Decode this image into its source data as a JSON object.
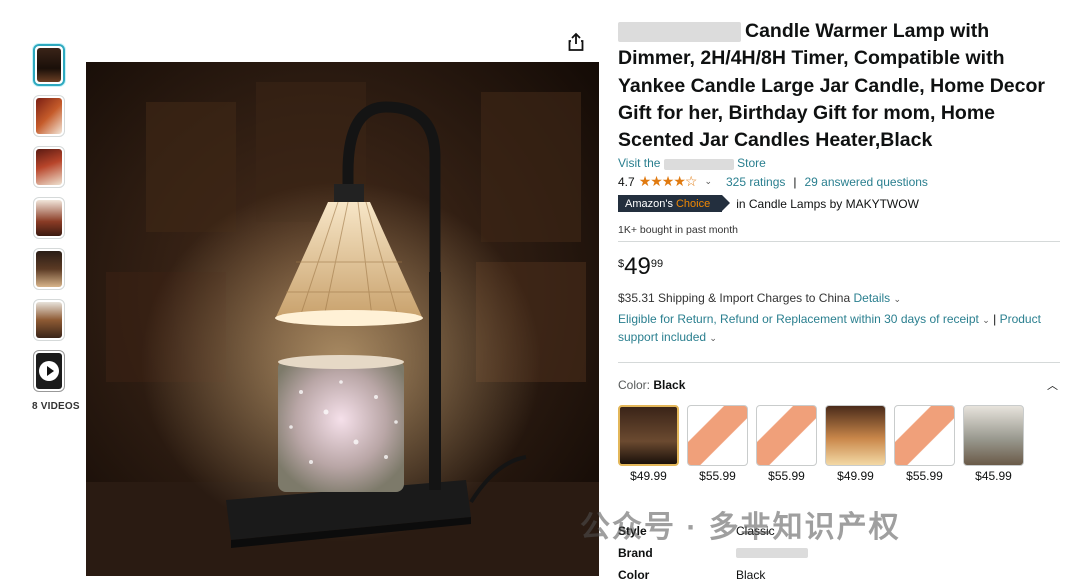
{
  "thumbnails": [
    {
      "name": "thumb-1",
      "selected": true
    },
    {
      "name": "thumb-2",
      "selected": false
    },
    {
      "name": "thumb-3",
      "selected": false
    },
    {
      "name": "thumb-4",
      "selected": false
    },
    {
      "name": "thumb-5",
      "selected": false
    },
    {
      "name": "thumb-6",
      "selected": false
    }
  ],
  "videos_label": "8 VIDEOS",
  "title_text": "Candle Warmer Lamp with Dimmer, 2H/4H/8H Timer, Compatible with Yankee Candle Large Jar Candle, Home Decor Gift for her, Birthday Gift for mom, Home Scented Jar Candles Heater,Black",
  "store": {
    "prefix": "Visit the",
    "suffix": "Store"
  },
  "rating": {
    "value": "4.7",
    "stars": "★★★★☆",
    "count": "325 ratings",
    "separator": "|",
    "questions": "29 answered questions"
  },
  "badge": {
    "amazons": "Amazon's",
    "choice": "Choice",
    "category": "in Candle Lamps by MAKYTWOW"
  },
  "bought": "1K+ bought in past month",
  "price": {
    "symbol": "$",
    "whole": "49",
    "fraction": "99"
  },
  "shipping": {
    "text": "$35.31 Shipping & Import Charges to China",
    "details": "Details"
  },
  "returns": {
    "text": "Eligible for Return, Refund or Replacement within 30 days of receipt",
    "sep": "|",
    "product": "Product",
    "support": "support included"
  },
  "color": {
    "label": "Color:",
    "value": "Black"
  },
  "swatches": [
    {
      "price": "$49.99",
      "selected": true
    },
    {
      "price": "$55.99",
      "selected": false
    },
    {
      "price": "$55.99",
      "selected": false
    },
    {
      "price": "$49.99",
      "selected": false
    },
    {
      "price": "$55.99",
      "selected": false
    },
    {
      "price": "$45.99",
      "selected": false
    }
  ],
  "attributes": [
    {
      "label": "Style",
      "value": "Classic"
    },
    {
      "label": "Brand",
      "value": ""
    },
    {
      "label": "Color",
      "value": "Black"
    }
  ],
  "watermark": "公众号 · 多芈知识产权",
  "icons": {
    "share": "share-icon",
    "chevron": "chevron-down-icon",
    "collapse": "chevron-up-icon",
    "play": "play-icon"
  },
  "colors": {
    "link": "#2a7f8f",
    "star": "#e07a10",
    "badge_bg": "#232f3e",
    "badge_choice": "#f08804",
    "selected_thumb": "#2ea9bf"
  }
}
